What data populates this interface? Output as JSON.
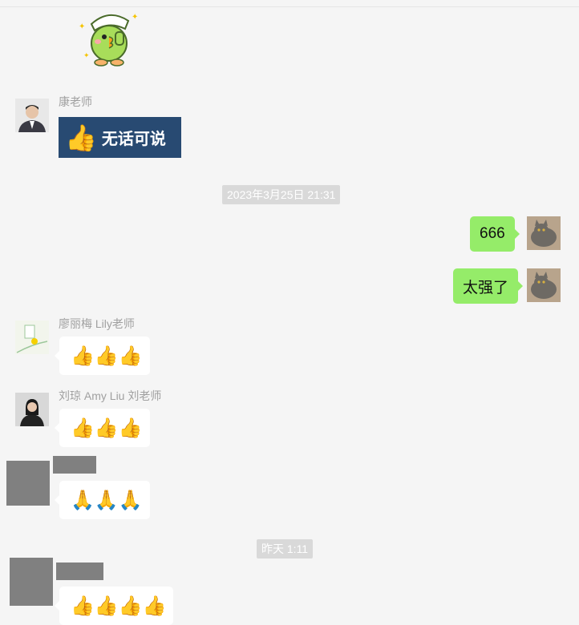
{
  "messages": [
    {
      "sender": "康老师",
      "image_text": "无话可说"
    },
    {
      "sender": "廖丽梅 Lily老师",
      "content": "👍👍👍"
    },
    {
      "sender": "刘琼 Amy Liu 刘老师",
      "content": "👍👍👍"
    },
    {
      "sender": "",
      "content": "🙏🙏🙏"
    },
    {
      "sender": "",
      "content": "👍👍👍👍"
    }
  ],
  "self_messages": [
    {
      "content": "666"
    },
    {
      "content": "太强了"
    }
  ],
  "timestamps": [
    "2023年3月25日 21:31",
    "昨天 1:11"
  ],
  "colors": {
    "background": "#f5f5f5",
    "self_bubble": "#95ec69",
    "other_bubble": "#ffffff",
    "timestamp_bg": "#d9d9d9",
    "image_card": "#284a72"
  },
  "icons": {
    "sticker": "parrot-thumbs-up-sticker",
    "thumbs_up": "thumbs-up-icon"
  }
}
